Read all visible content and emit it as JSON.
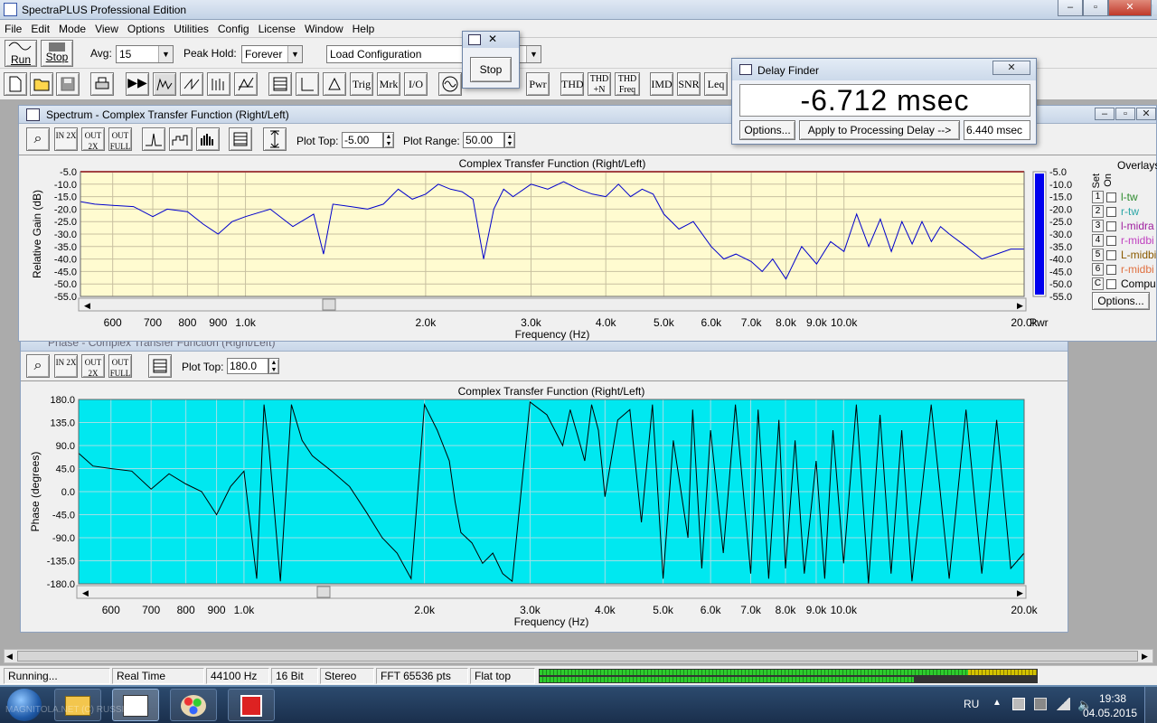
{
  "app": {
    "title": "SpectraPLUS Professional Edition",
    "watermark": "MAGNITOLA"
  },
  "menu": [
    "File",
    "Edit",
    "Mode",
    "View",
    "Options",
    "Utilities",
    "Config",
    "License",
    "Window",
    "Help"
  ],
  "toolbar": {
    "run_label": "Run",
    "stop_label": "Stop",
    "avg_label": "Avg:",
    "avg_value": "15",
    "peak_label": "Peak Hold:",
    "peak_value": "Forever",
    "config_value": "Load Configuration",
    "text_buttons": [
      "Trig",
      "Mrk",
      "I/O",
      "Pwr",
      "THD",
      "THD +N",
      "THD Freq",
      "IMD",
      "SNR",
      "Leq"
    ]
  },
  "stop_dialog": {
    "button": "Stop"
  },
  "delay_finder": {
    "title": "Delay Finder",
    "value": "-6.712 msec",
    "options_btn": "Options...",
    "apply_btn": "Apply to Processing Delay -->",
    "delay_value": "6.440 msec"
  },
  "spectrum": {
    "title": "Spectrum - Complex Transfer Function (Right/Left)",
    "zoom_buttons": [
      "IN 2X",
      "OUT 2X",
      "OUT FULL"
    ],
    "plot_top_label": "Plot Top:",
    "plot_top_value": "-5.00",
    "plot_range_label": "Plot Range:",
    "plot_range_value": "50.00",
    "overlays_label": "Overlays",
    "set_label": "Set",
    "on_label": "On",
    "overlays": [
      {
        "num": "1",
        "name": "l-tw",
        "color": "#2e8b2e"
      },
      {
        "num": "2",
        "name": "r-tw",
        "color": "#2aa6a6"
      },
      {
        "num": "3",
        "name": "l-midra",
        "color": "#a020a0"
      },
      {
        "num": "4",
        "name": "r-midbi",
        "color": "#c040c0"
      },
      {
        "num": "5",
        "name": "L-midbi",
        "color": "#8a5a00"
      },
      {
        "num": "6",
        "name": "r-midbi",
        "color": "#e07040"
      },
      {
        "num": "C",
        "name": "Compu",
        "color": "#000000"
      }
    ],
    "options_btn": "Options...",
    "pwr_label": "Pwr"
  },
  "phase": {
    "title": "Phase - Complex Transfer Function (Right/Left)",
    "zoom_buttons": [
      "IN 2X",
      "OUT 2X",
      "OUT FULL"
    ],
    "plot_top_label": "Plot Top:",
    "plot_top_value": "180.0"
  },
  "status": {
    "cells": [
      "Running...",
      "Real Time",
      "44100 Hz",
      "16 Bit",
      "Stereo",
      "FFT 65536 pts",
      "Flat top"
    ]
  },
  "taskbar": {
    "lang": "RU",
    "time": "19:38",
    "date": "04.05.2015",
    "watermark": "MAGNITOLA.NET (C) RUSSIAN"
  },
  "chart_data": [
    {
      "type": "line",
      "title": "Complex Transfer Function (Right/Left)",
      "xlabel": "Frequency (Hz)",
      "ylabel": "Relative Gain (dB)",
      "xscale": "log",
      "xlim": [
        530,
        20000
      ],
      "ylim": [
        -55,
        -5
      ],
      "yticks": [
        -5,
        -10,
        -15,
        -20,
        -25,
        -30,
        -35,
        -40,
        -45,
        -50,
        -55
      ],
      "xticks": [
        "600",
        "700",
        "800",
        "900",
        "1.0k",
        "2.0k",
        "3.0k",
        "4.0k",
        "5.0k",
        "6.0k",
        "7.0k",
        "8.0k",
        "9.0k",
        "10.0k",
        "20.0k"
      ],
      "right_scale_ticks": [
        "-5.0",
        "-10.0",
        "-15.0",
        "-20.0",
        "-25.0",
        "-30.0",
        "-35.0",
        "-40.0",
        "-45.0",
        "-50.0",
        "-55.0"
      ],
      "background": "#fffbd0",
      "line_color": "#0000cc",
      "series": [
        {
          "x": [
            530,
            560,
            600,
            650,
            700,
            740,
            800,
            850,
            900,
            950,
            1000,
            1100,
            1200,
            1300,
            1350,
            1400,
            1500,
            1600,
            1700,
            1800,
            1900,
            2000,
            2100,
            2200,
            2300,
            2400,
            2500,
            2600,
            2700,
            2800,
            3000,
            3200,
            3400,
            3600,
            3800,
            4000,
            4200,
            4400,
            4600,
            4800,
            5000,
            5300,
            5600,
            6000,
            6300,
            6600,
            7000,
            7300,
            7600,
            8000,
            8500,
            9000,
            9500,
            10000,
            10500,
            11000,
            11500,
            12000,
            12500,
            13000,
            13500,
            14000,
            14500,
            15000,
            16000,
            17000,
            18000,
            19000,
            20000
          ],
          "y": [
            -17,
            -18,
            -18.5,
            -19,
            -23,
            -20,
            -21,
            -26,
            -30,
            -25,
            -23,
            -20,
            -27,
            -22,
            -38,
            -18,
            -19,
            -20,
            -18,
            -12,
            -16,
            -14,
            -10,
            -12,
            -13,
            -16,
            -40,
            -20,
            -12,
            -15,
            -10,
            -12,
            -9,
            -12,
            -14,
            -15,
            -10,
            -15,
            -12,
            -14,
            -22,
            -28,
            -25,
            -35,
            -40,
            -38,
            -41,
            -45,
            -40,
            -48,
            -35,
            -42,
            -33,
            -37,
            -22,
            -35,
            -24,
            -37,
            -25,
            -34,
            -25,
            -33,
            -27,
            -30,
            -35,
            -40,
            -38,
            -36,
            -36
          ]
        }
      ]
    },
    {
      "type": "line",
      "title": "Complex Transfer Function (Right/Left)",
      "xlabel": "Frequency (Hz)",
      "ylabel": "Phase (degrees)",
      "xscale": "log",
      "xlim": [
        530,
        20000
      ],
      "ylim": [
        -180,
        180
      ],
      "yticks": [
        180,
        135,
        90,
        45,
        0,
        -45,
        -90,
        -135,
        -180
      ],
      "xticks": [
        "600",
        "700",
        "800",
        "900",
        "1.0k",
        "2.0k",
        "3.0k",
        "4.0k",
        "5.0k",
        "6.0k",
        "7.0k",
        "8.0k",
        "9.0k",
        "10.0k",
        "20.0k"
      ],
      "background": "#00e8f0",
      "line_color": "#000000",
      "series": [
        {
          "x": [
            530,
            560,
            600,
            650,
            700,
            750,
            800,
            850,
            900,
            950,
            1000,
            1050,
            1080,
            1100,
            1150,
            1200,
            1250,
            1300,
            1400,
            1500,
            1600,
            1700,
            1800,
            1900,
            2000,
            2100,
            2200,
            2250,
            2300,
            2400,
            2500,
            2600,
            2700,
            2800,
            3000,
            3200,
            3400,
            3500,
            3600,
            3700,
            3800,
            3900,
            4000,
            4200,
            4400,
            4600,
            4800,
            5000,
            5200,
            5500,
            5600,
            5800,
            6000,
            6300,
            6600,
            7000,
            7200,
            7500,
            7800,
            8000,
            8300,
            8600,
            9000,
            9300,
            9600,
            10000,
            10500,
            11000,
            11500,
            12000,
            12500,
            13000,
            14000,
            15000,
            16000,
            17000,
            18000,
            19000,
            20000
          ],
          "y": [
            75,
            50,
            45,
            40,
            5,
            35,
            15,
            0,
            -45,
            10,
            40,
            -170,
            170,
            90,
            -175,
            170,
            100,
            70,
            40,
            10,
            -40,
            -90,
            -120,
            -170,
            170,
            120,
            60,
            -20,
            -80,
            -100,
            -140,
            -120,
            -160,
            -175,
            175,
            150,
            90,
            160,
            110,
            60,
            170,
            120,
            -10,
            140,
            160,
            -60,
            170,
            -170,
            100,
            -90,
            160,
            -150,
            120,
            -120,
            170,
            -160,
            160,
            -170,
            140,
            -150,
            100,
            -160,
            60,
            -170,
            120,
            -140,
            170,
            -180,
            150,
            -160,
            120,
            -175,
            170,
            -170,
            160,
            -160,
            140,
            -150,
            -120
          ]
        }
      ]
    }
  ]
}
